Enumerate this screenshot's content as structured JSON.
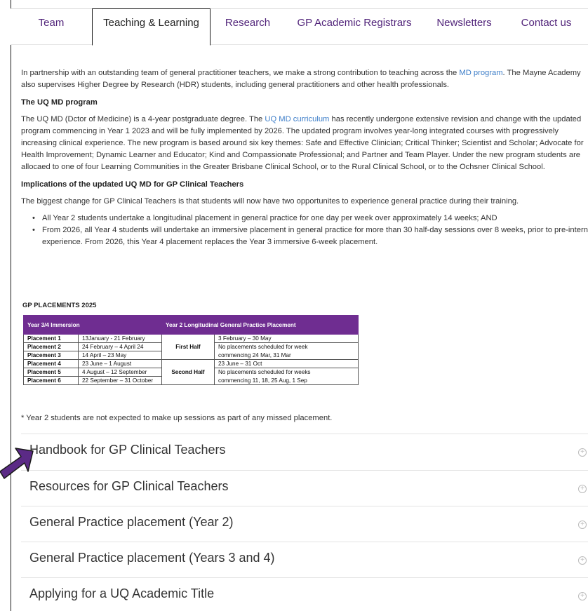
{
  "tabs": [
    {
      "label": "Team"
    },
    {
      "label": "Teaching & Learning"
    },
    {
      "label": "Research"
    },
    {
      "label": "GP Academic Registrars"
    },
    {
      "label": "Newsletters"
    },
    {
      "label": "Contact us"
    }
  ],
  "intro": {
    "part1": "In partnership with an outstanding team of general practitioner teachers, we make a strong contribution to teaching across the ",
    "link": "MD program",
    "part2": ". The Mayne Academy also supervises Higher Degree by Research (HDR) students, including general practitioners and other health professionals."
  },
  "md": {
    "heading": "The UQ MD program",
    "part1": "The UQ MD (Dctor of Medicine) is a 4-year postgraduate degree.  The ",
    "link": "UQ MD curriculum",
    "part2": " has recently undergone extensive revision and change with the updated program commencing in Year 1 2023 and will be fully implemented by 2026.  The updated program involves year-long integrated courses with progressively increasing clinical experience.  The new program is based around six key themes:  Safe and Effective Clinician; Critical Thinker; Scientist and Scholar; Advocate for Health Improvement; Dynamic Learner and Educator; Kind and Compassionate Professional; and Partner and Team Player.  Under the new program students are allocaed to one of four Learning Communities in the Greater Brisbane Clinical School, or to the Rural Clinical School, or to the Ochsner Clinical School."
  },
  "implications": {
    "heading": "Implications of the updated UQ MD for GP Clinical Teachers",
    "text": "The biggest change for GP Clinical Teachers is that students will now have two opportunites to experience general practice during their training.",
    "bullets": [
      "All Year 2 students undertake a longitudinal placement in general practice for one day per week over approximately 14 weeks; AND",
      "From 2026, all Year 4 students will undertake an immersive placement in general practice for more than 30 half-day sessions over 8 weeks, prior to pre-intern experience.  From 2026, this Year 4 placement replaces the Year 3 immersive 6-week placement."
    ]
  },
  "table": {
    "title": "GP PLACEMENTS 2025",
    "header_left": "Year 3/4 Immersion",
    "header_right": "Year 2 Longitudinal General Practice Placement",
    "rows": [
      {
        "placement": "Placement 1",
        "dates": "13January - 21 February"
      },
      {
        "placement": "Placement 2",
        "dates": "24 February – 4 April 24"
      },
      {
        "placement": "Placement 3",
        "dates": "14 April – 23 May"
      },
      {
        "placement": "Placement 4",
        "dates": "23 June – 1 August"
      },
      {
        "placement": "Placement 5",
        "dates": "4 August – 12 September"
      },
      {
        "placement": "Placement 6",
        "dates": "22 September – 31 October"
      }
    ],
    "first_half": "First Half",
    "second_half": "Second Half",
    "y2": [
      "3 February – 30 May",
      "No placements scheduled for week",
      "commencing 24 Mar, 31 Mar",
      "23 June – 31 Oct",
      "No placements scheduled for weeks",
      "commencing 11, 18, 25 Aug, 1 Sep"
    ]
  },
  "note": "* Year 2 students are not expected to make up sessions as part of any missed placement.",
  "accordions": [
    {
      "label": "Handbook for GP Clinical Teachers"
    },
    {
      "label": "Resources for GP Clinical Teachers"
    },
    {
      "label": "General Practice placement (Year 2)"
    },
    {
      "label": "General Practice placement (Years 3 and 4)"
    },
    {
      "label": "Applying for a UQ Academic Title"
    }
  ],
  "colors": {
    "brand_purple": "#51247a",
    "table_header": "#6f2d91",
    "link_blue": "#3c7dc8",
    "arrow": "#5b2a86"
  }
}
